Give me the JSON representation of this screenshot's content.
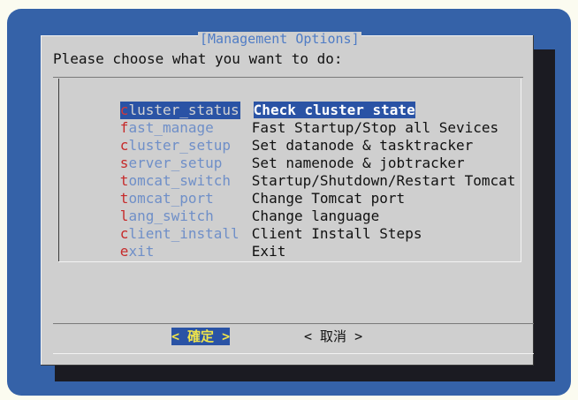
{
  "dialog": {
    "title": "[Management Options]",
    "prompt": "Please choose what you want to do:"
  },
  "menu": [
    {
      "hot": "c",
      "rest": "luster_status",
      "desc": "Check cluster state",
      "selected": true
    },
    {
      "hot": "f",
      "rest": "ast_manage",
      "desc": "Fast Startup/Stop all Sevices",
      "selected": false
    },
    {
      "hot": "c",
      "rest": "luster_setup",
      "desc": "Set datanode & tasktracker",
      "selected": false
    },
    {
      "hot": "s",
      "rest": "erver_setup",
      "desc": "Set namenode & jobtracker",
      "selected": false
    },
    {
      "hot": "t",
      "rest": "omcat_switch",
      "desc": "Startup/Shutdown/Restart Tomcat",
      "selected": false
    },
    {
      "hot": "t",
      "rest": "omcat_port",
      "desc": "Change Tomcat port",
      "selected": false
    },
    {
      "hot": "l",
      "rest": "ang_switch",
      "desc": "Change language",
      "selected": false
    },
    {
      "hot": "c",
      "rest": "lient_install",
      "desc": "Client Install Steps",
      "selected": false
    },
    {
      "hot": "e",
      "rest": "xit",
      "desc": "Exit",
      "selected": false
    }
  ],
  "buttons": {
    "ok": "< 確定 >",
    "cancel": "< 取消 >"
  },
  "colors": {
    "screen_bg": "#3562a8",
    "dialog_bg": "#cfcfcf",
    "highlight": "#2a53a5",
    "hotkey": "#c62a2a",
    "tag": "#6f8fc8",
    "ok_text": "#f0e44a"
  }
}
